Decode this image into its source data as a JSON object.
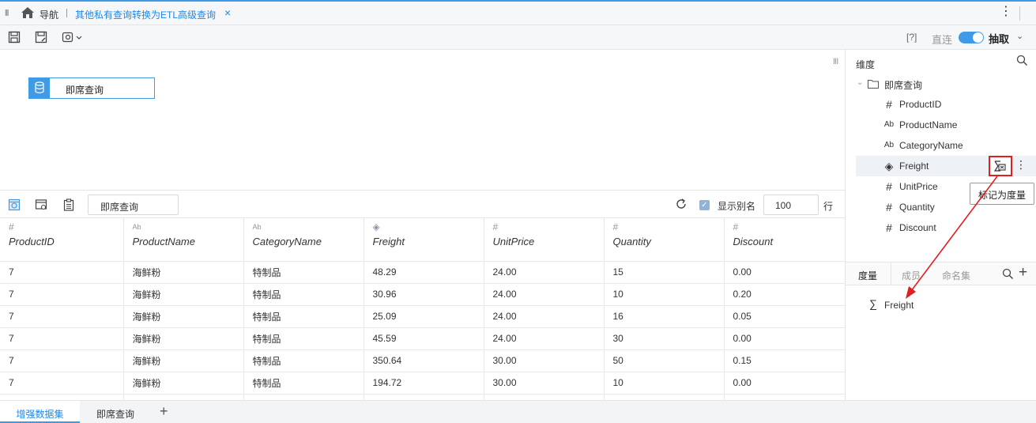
{
  "topbar": {
    "nav_label": "导航",
    "tab_title": "其他私有查询转换为ETL高级查询",
    "close_glyph": "×",
    "more_glyph": "⋮"
  },
  "toolbar": {
    "help_label": "[?]",
    "direct_label": "直连",
    "extract_label": "抽取",
    "extract_caret": "⌄",
    "toggle_on": true
  },
  "canvas": {
    "node_label": "即席查询"
  },
  "preview": {
    "dataset_name": "即席查询",
    "show_alias_label": "显示别名",
    "show_alias_checked": true,
    "row_count": "100",
    "row_unit": "行"
  },
  "grid": {
    "columns": [
      {
        "name": "ProductID",
        "type": "#"
      },
      {
        "name": "ProductName",
        "type": "Ab"
      },
      {
        "name": "CategoryName",
        "type": "Ab"
      },
      {
        "name": "Freight",
        "type": "◈"
      },
      {
        "name": "UnitPrice",
        "type": "#"
      },
      {
        "name": "Quantity",
        "type": "#"
      },
      {
        "name": "Discount",
        "type": "#"
      }
    ],
    "rows": [
      [
        "7",
        "海鲜粉",
        "特制品",
        "48.29",
        "24.00",
        "15",
        "0.00"
      ],
      [
        "7",
        "海鲜粉",
        "特制品",
        "30.96",
        "24.00",
        "10",
        "0.20"
      ],
      [
        "7",
        "海鲜粉",
        "特制品",
        "25.09",
        "24.00",
        "16",
        "0.05"
      ],
      [
        "7",
        "海鲜粉",
        "特制品",
        "45.59",
        "24.00",
        "30",
        "0.00"
      ],
      [
        "7",
        "海鲜粉",
        "特制品",
        "350.64",
        "30.00",
        "50",
        "0.15"
      ],
      [
        "7",
        "海鲜粉",
        "特制品",
        "194.72",
        "30.00",
        "10",
        "0.00"
      ],
      [
        "",
        "",
        "",
        "",
        "",
        "",
        ""
      ]
    ]
  },
  "bottom_tabs": [
    {
      "label": "增强数据集",
      "active": true
    },
    {
      "label": "即席查询",
      "active": false
    }
  ],
  "bottom_add": "+",
  "right_panel": {
    "dimension_title": "维度",
    "tree_root": "即席查询",
    "fields": [
      {
        "name": "ProductID",
        "type": "#"
      },
      {
        "name": "ProductName",
        "type": "Ab"
      },
      {
        "name": "CategoryName",
        "type": "Ab"
      },
      {
        "name": "Freight",
        "type": "◈"
      },
      {
        "name": "UnitPrice",
        "type": "#"
      },
      {
        "name": "Quantity",
        "type": "#"
      },
      {
        "name": "Discount",
        "type": "#"
      }
    ],
    "tooltip": "标记为度量",
    "tabs": [
      {
        "label": "度量",
        "active": true
      },
      {
        "label": "成员",
        "active": false
      },
      {
        "label": "命名集",
        "active": false
      }
    ],
    "measures": [
      "Freight"
    ],
    "sigma_glyph": "∑",
    "plus_glyph": "+"
  },
  "colors": {
    "accent": "#3f9be6",
    "link": "#1e88e5",
    "highlight_border": "#e02020"
  }
}
